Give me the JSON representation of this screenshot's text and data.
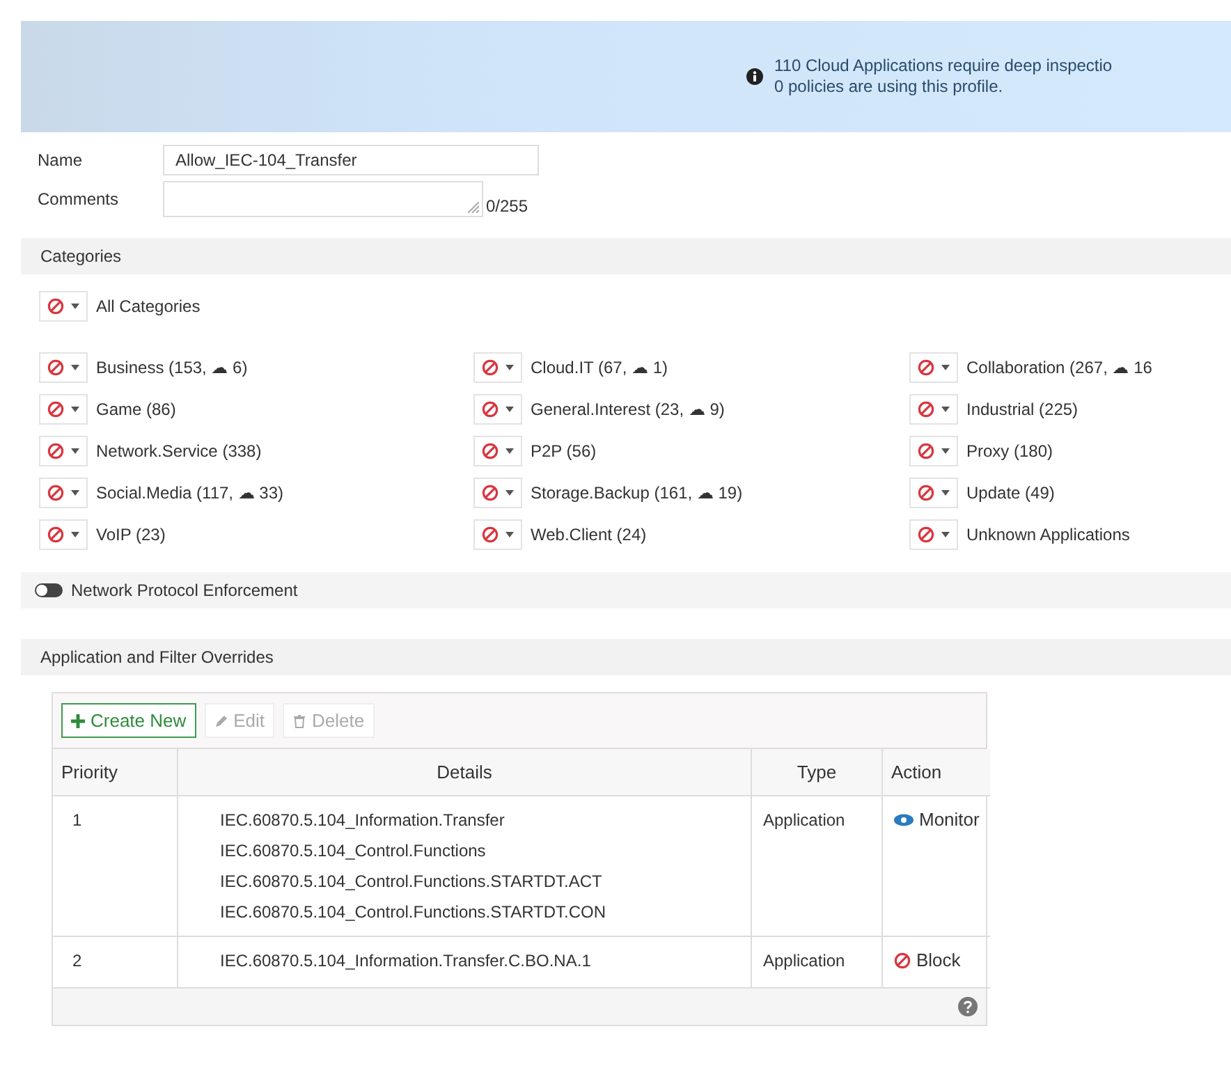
{
  "banner": {
    "lines": [
      "110 Cloud Applications require deep inspectio",
      "0 policies are using this profile."
    ]
  },
  "form": {
    "name_label": "Name",
    "name_value": "Allow_IEC-104_Transfer",
    "comments_label": "Comments",
    "comments_counter": "0/255"
  },
  "categories": {
    "title": "Categories",
    "all_label": "All Categories",
    "items": [
      {
        "label": "Business (153, ☁ 6)",
        "kind": "block"
      },
      {
        "label": "Cloud.IT (67, ☁ 1)",
        "kind": "block"
      },
      {
        "label": "Collaboration (267, ☁ 16",
        "kind": "block"
      },
      {
        "label": "Game (86)",
        "kind": "block"
      },
      {
        "label": "General.Interest (23, ☁ 9)",
        "kind": "block"
      },
      {
        "label": "Industrial (225)",
        "kind": "block"
      },
      {
        "label": "Network.Service (338)",
        "kind": "block"
      },
      {
        "label": "P2P (56)",
        "kind": "block"
      },
      {
        "label": "Proxy (180)",
        "kind": "block"
      },
      {
        "label": "Social.Media (117, ☁ 33)",
        "kind": "block"
      },
      {
        "label": "Storage.Backup (161, ☁ 19)",
        "kind": "block"
      },
      {
        "label": "Update (49)",
        "kind": "block"
      },
      {
        "label": "VoIP (23)",
        "kind": "block"
      },
      {
        "label": "Web.Client (24)",
        "kind": "block"
      },
      {
        "label": "Unknown Applications",
        "kind": "block"
      }
    ]
  },
  "protocol_enforcement": {
    "label": "Network Protocol Enforcement",
    "on": false
  },
  "overrides": {
    "title": "Application and Filter Overrides",
    "toolbar": [
      {
        "label": "Create New",
        "kind": "create",
        "disabled": false
      },
      {
        "label": "Edit",
        "kind": "edit",
        "disabled": true
      },
      {
        "label": "Delete",
        "kind": "delete",
        "disabled": true
      }
    ],
    "columns": [
      "Priority",
      "Details",
      "Type",
      "Action"
    ],
    "rows": [
      {
        "priority": "1",
        "details": [
          "IEC.60870.5.104_Information.Transfer",
          "IEC.60870.5.104_Control.Functions",
          "IEC.60870.5.104_Control.Functions.STARTDT.ACT",
          "IEC.60870.5.104_Control.Functions.STARTDT.CON"
        ],
        "type": "Application",
        "action": {
          "kind": "monitor",
          "label": "Monitor"
        }
      },
      {
        "priority": "2",
        "details": [
          "IEC.60870.5.104_Information.Transfer.C.BO.NA.1"
        ],
        "type": "Application",
        "action": {
          "kind": "block",
          "label": "Block"
        }
      }
    ]
  }
}
